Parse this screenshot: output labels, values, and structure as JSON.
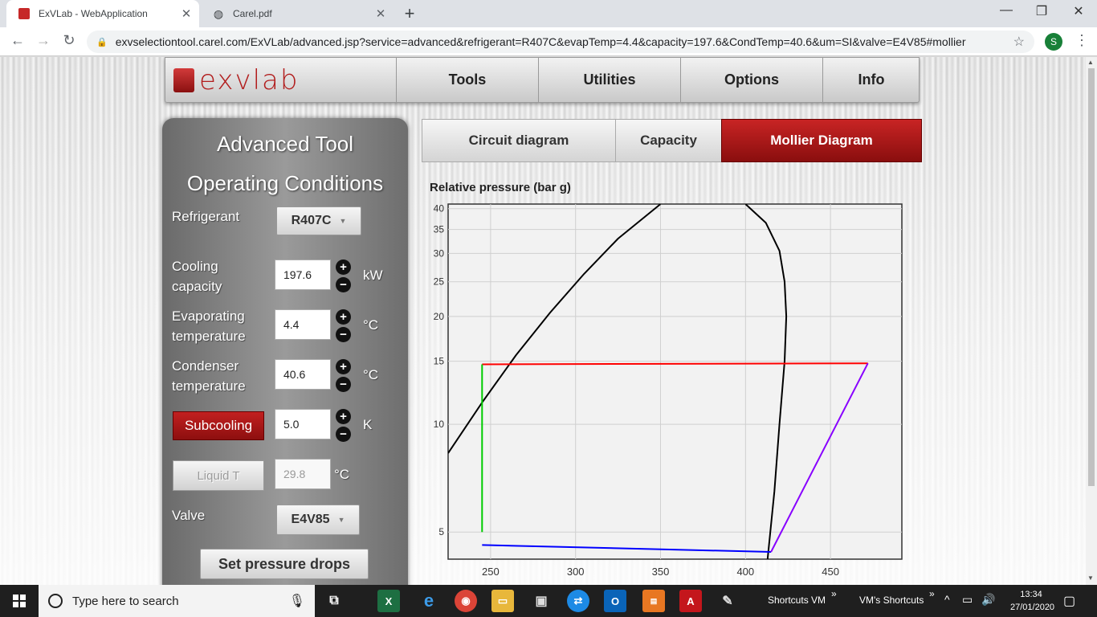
{
  "browser": {
    "tabs": [
      {
        "title": "ExVLab - WebApplication",
        "active": true
      },
      {
        "title": "Carel.pdf",
        "active": false
      }
    ],
    "url": "exvselectiontool.carel.com/ExVLab/advanced.jsp?service=advanced&refrigerant=R407C&evapTemp=4.4&capacity=197.6&CondTemp=40.6&um=SI&valve=E4V85#mollier",
    "profile_initial": "S"
  },
  "app": {
    "logo_text": "exvlab",
    "menu": [
      "Tools",
      "Utilities",
      "Options",
      "Info"
    ]
  },
  "panel": {
    "title1": "Advanced Tool",
    "title2": "Operating Conditions",
    "refrigerant_label": "Refrigerant",
    "refrigerant_value": "R407C",
    "capacity_label1": "Cooling",
    "capacity_label2": "capacity",
    "capacity_value": "197.6",
    "capacity_unit": "kW",
    "evap_label1": "Evaporating",
    "evap_label2": "temperature",
    "evap_value": "4.4",
    "evap_unit": "°C",
    "cond_label1": "Condenser",
    "cond_label2": "temperature",
    "cond_value": "40.6",
    "cond_unit": "°C",
    "subcooling_label": "Subcooling",
    "subcooling_value": "5.0",
    "subcooling_unit": "K",
    "liquid_label": "Liquid T",
    "liquid_value": "29.8",
    "liquid_unit": "°C",
    "valve_label": "Valve",
    "valve_value": "E4V85",
    "pressure_drops_label": "Set pressure drops",
    "plus": "+",
    "minus": "−"
  },
  "view_tabs": [
    {
      "label": "Circuit diagram",
      "active": false
    },
    {
      "label": "Capacity",
      "active": false
    },
    {
      "label": "Mollier Diagram",
      "active": true
    }
  ],
  "chart_data": {
    "type": "line",
    "ylabel": "Relative pressure (bar g)",
    "y_scale": "log",
    "x_ticks": [
      250,
      300,
      350,
      400,
      450
    ],
    "y_ticks": [
      5,
      10,
      15,
      20,
      25,
      30,
      35,
      40
    ],
    "xlim": [
      225,
      492
    ],
    "ylim": [
      4.2,
      41.2
    ],
    "grid": true,
    "series": [
      {
        "color": "#000000",
        "points": [
          [
            225,
            8.3
          ],
          [
            245,
            11.5
          ],
          [
            265,
            15.6
          ],
          [
            285,
            20.5
          ],
          [
            305,
            26.3
          ],
          [
            325,
            33
          ],
          [
            350,
            41.2
          ]
        ]
      },
      {
        "color": "#000000",
        "points": [
          [
            400,
            41.2
          ],
          [
            412,
            36.5
          ],
          [
            420,
            30.5
          ],
          [
            423,
            25
          ],
          [
            424,
            20
          ],
          [
            423,
            15
          ],
          [
            420,
            10
          ],
          [
            417,
            6.5
          ],
          [
            413,
            4.2
          ]
        ]
      },
      {
        "color": "#ff0000",
        "points": [
          [
            245,
            14.7
          ],
          [
            472,
            14.8
          ]
        ]
      },
      {
        "color": "#00cc00",
        "points": [
          [
            245,
            14.7
          ],
          [
            245,
            5.0
          ]
        ]
      },
      {
        "color": "#0000ff",
        "points": [
          [
            245,
            4.6
          ],
          [
            415,
            4.4
          ]
        ]
      },
      {
        "color": "#8800ff",
        "points": [
          [
            415,
            4.4
          ],
          [
            472,
            14.8
          ]
        ]
      }
    ]
  },
  "taskbar": {
    "search_placeholder": "Type here to search",
    "shortcuts1": "Shortcuts VM",
    "shortcuts2": "VM's Shortcuts",
    "time": "13:34",
    "date": "27/01/2020"
  }
}
